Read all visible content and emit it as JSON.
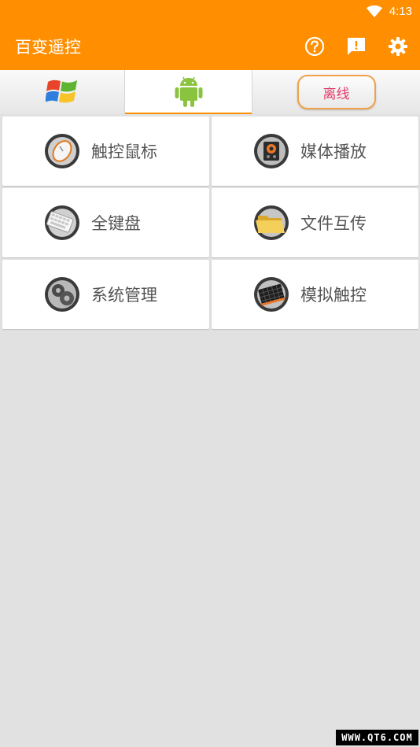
{
  "status_bar": {
    "time": "4:13",
    "icons": [
      "wifi-icon"
    ]
  },
  "app_bar": {
    "title": "百变遥控",
    "actions": [
      "help-icon",
      "feedback-icon",
      "settings-icon"
    ]
  },
  "tabs": [
    {
      "icon": "windows-logo-icon"
    },
    {
      "icon": "android-robot-icon",
      "selected": true
    },
    {
      "label": "离线"
    }
  ],
  "menu": [
    {
      "label": "触控鼠标",
      "icon": "mouse-icon"
    },
    {
      "label": "媒体播放",
      "icon": "media-player-icon"
    },
    {
      "label": "全键盘",
      "icon": "keyboard-icon"
    },
    {
      "label": "文件互传",
      "icon": "folder-icon"
    },
    {
      "label": "系统管理",
      "icon": "gears-icon"
    },
    {
      "label": "模拟触控",
      "icon": "touchpad-icon"
    }
  ],
  "watermark": "WWW.QT6.COM",
  "colors": {
    "accent": "#ff8f00",
    "background": "#e1e1e1",
    "offline_text": "#e03a6a"
  }
}
